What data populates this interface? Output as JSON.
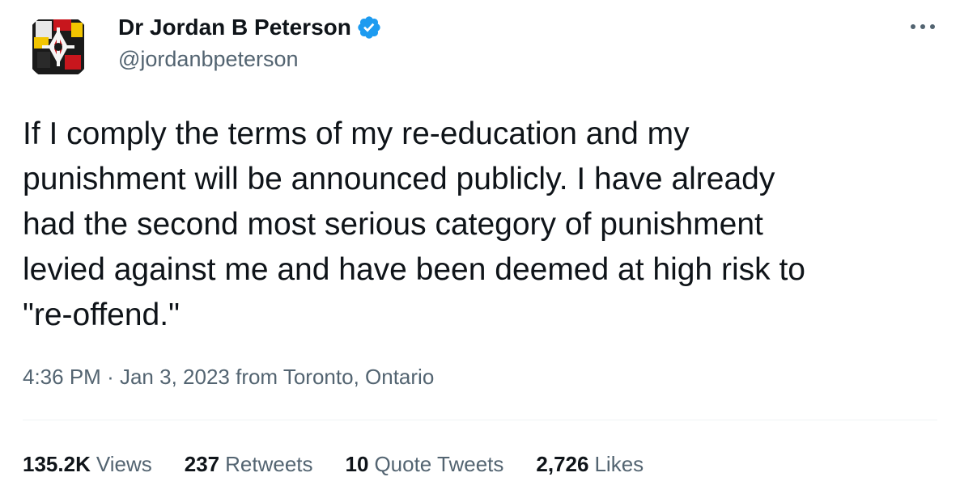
{
  "author": {
    "name": "Dr Jordan B Peterson",
    "handle": "@jordanbpeterson",
    "verified": true
  },
  "tweet": {
    "text_lines": [
      "If I comply the terms of my re-education and my",
      "punishment will be announced publicly. I have already",
      "had the second most serious category of punishment",
      "levied against me and have been deemed at high risk to",
      "\"re-offend.\""
    ],
    "time": "4:36 PM",
    "separator": "·",
    "date": "Jan 3, 2023",
    "source": "from Toronto, Ontario"
  },
  "stats": {
    "views": {
      "count": "135.2K",
      "label": "Views"
    },
    "retweets": {
      "count": "237",
      "label": "Retweets"
    },
    "quote_tweets": {
      "count": "10",
      "label": "Quote Tweets"
    },
    "likes": {
      "count": "2,726",
      "label": "Likes"
    }
  },
  "icons": {
    "verified": "verified-badge-icon",
    "more": "more-options-icon"
  },
  "colors": {
    "primary_text": "#0f1419",
    "secondary_text": "#536471",
    "verified_blue": "#1d9bf0",
    "divider": "#eff3f4"
  }
}
